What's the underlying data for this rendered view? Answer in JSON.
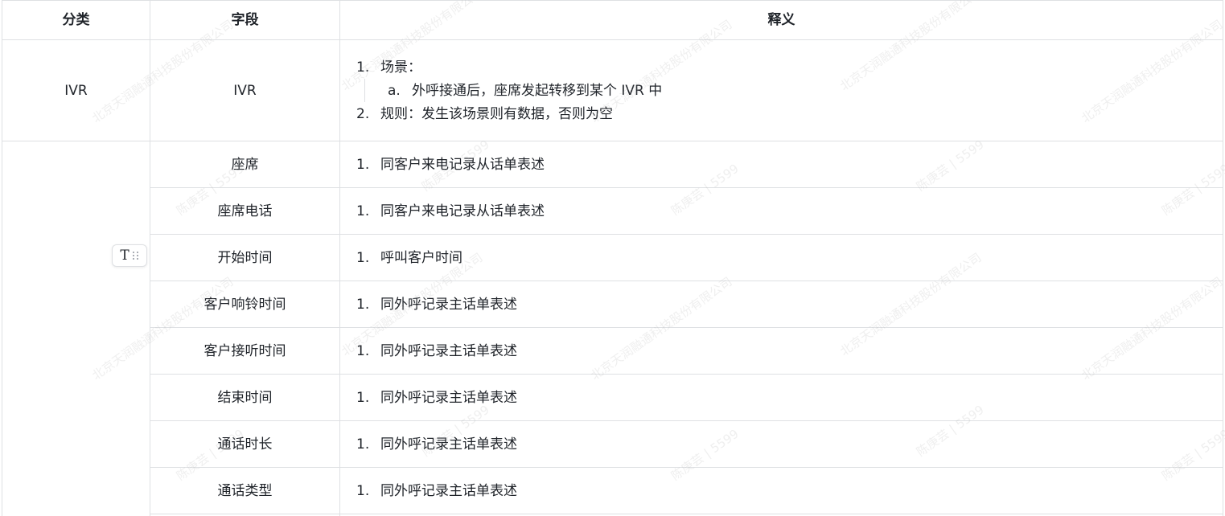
{
  "table": {
    "headers": {
      "category": "分类",
      "field": "字段",
      "description": "释义"
    },
    "ivr_row": {
      "category": "IVR",
      "field": "IVR",
      "items": [
        {
          "num": "1.",
          "text": "场景："
        },
        {
          "num": "a.",
          "text": "外呼接通后，座席发起转移到某个 IVR 中"
        },
        {
          "num": "2.",
          "text": "规则：发生该场景则有数据，否则为空"
        }
      ]
    },
    "rows": [
      {
        "field": "座席",
        "num": "1.",
        "desc": "同客户来电记录从话单表述"
      },
      {
        "field": "座席电话",
        "num": "1.",
        "desc": "同客户来电记录从话单表述"
      },
      {
        "field": "开始时间",
        "num": "1.",
        "desc": "呼叫客户时间"
      },
      {
        "field": "客户响铃时间",
        "num": "1.",
        "desc": "同外呼记录主话单表述"
      },
      {
        "field": "客户接听时间",
        "num": "1.",
        "desc": "同外呼记录主话单表述"
      },
      {
        "field": "结束时间",
        "num": "1.",
        "desc": "同外呼记录主话单表述"
      },
      {
        "field": "通话时长",
        "num": "1.",
        "desc": "同外呼记录主话单表述"
      },
      {
        "field": "通话类型",
        "num": "1.",
        "desc": "同外呼记录主话单表述"
      }
    ]
  },
  "toolbar": {
    "text_icon": "T",
    "drag_icon": "drag-handle-icon"
  },
  "watermark": {
    "company": "北京天润融通科技股份有限公司",
    "user": "陈庚芸 | 5599"
  }
}
